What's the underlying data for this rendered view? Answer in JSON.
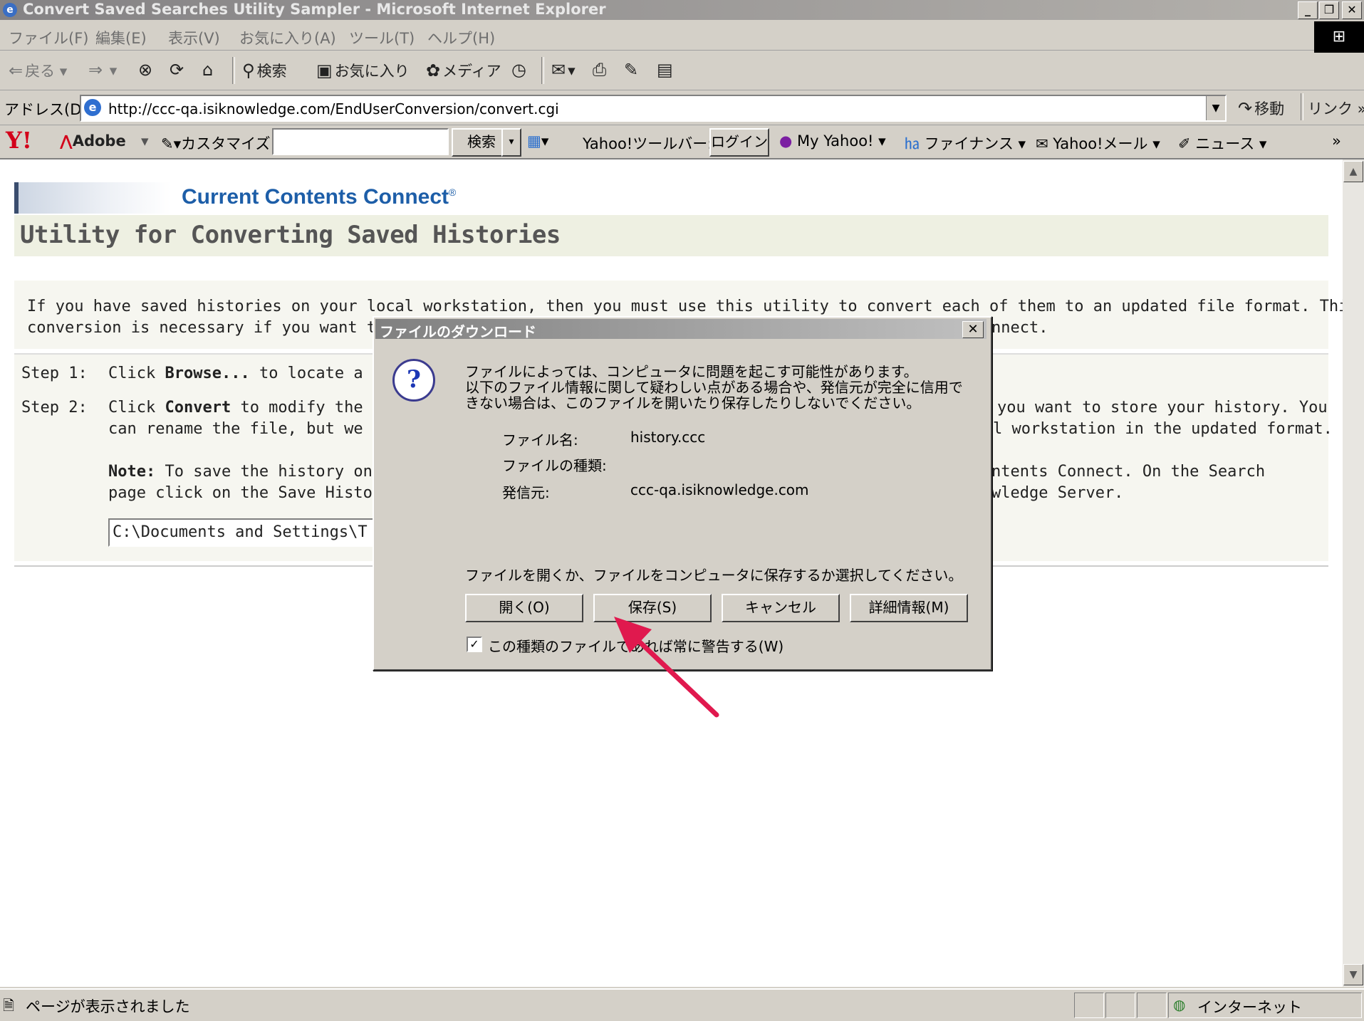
{
  "window": {
    "title": "Convert Saved Searches Utility Sampler - Microsoft Internet Explorer",
    "minimize": "_",
    "maximize": "❐",
    "close": "✕"
  },
  "menubar": {
    "items": [
      "ファイル(F)",
      "編集(E)",
      "表示(V)",
      "お気に入り(A)",
      "ツール(T)",
      "ヘルプ(H)"
    ]
  },
  "toolbar": {
    "back": "戻る",
    "search": "検索",
    "favorites": "お気に入り",
    "media": "メディア"
  },
  "address": {
    "label": "アドレス(D)",
    "url": "http://ccc-qa.isiknowledge.com/EndUserConversion/convert.cgi",
    "go": "移動",
    "links": "リンク"
  },
  "yahoo_toolbar": {
    "logo": "Y!",
    "adobe": "Adobe",
    "customize": "カスタマイズ",
    "search_button": "検索",
    "toolbar_label": "Yahoo!ツールバー:",
    "login": "ログイン",
    "my_yahoo": "My Yahoo!",
    "finance": "ファイナンス",
    "mail": "Yahoo!メール",
    "news": "ニュース"
  },
  "page": {
    "brand": "Current Contents Connect",
    "brand_mark": "®",
    "title": "Utility for Converting Saved Histories",
    "intro_line1": "If you have saved histories on your local workstation, then you must use this utility to convert each of them to an updated file format. This",
    "intro_line2_left": "conversion is necessary if you want to",
    "intro_line2_right": "nnect.",
    "step1_label": "Step 1:",
    "step1_click": "Click ",
    "step1_bold": "Browse...",
    "step1_rest": " to locate a sa",
    "step2_label": "Step 2:",
    "step2_click": "Click ",
    "step2_bold": "Convert",
    "step2_rest": " to modify the s",
    "step2_right": "you want to store your history. You",
    "step2_line2_left": "can rename the file, but we re",
    "step2_line2_right": "l workstation in the updated format.",
    "note_bold": "Note:",
    "note_rest": " To save the history on",
    "note_right": "ntents Connect. On the Search",
    "note_line2_left": "page click on the Save Histor",
    "note_line2_right": "wledge Server.",
    "path_value": "C:\\Documents and Settings\\T"
  },
  "dialog": {
    "title": "ファイルのダウンロード",
    "close": "✕",
    "warning_line1": "ファイルによっては、コンピュータに問題を起こす可能性があります。",
    "warning_line2": "以下のファイル情報に関して疑わしい点がある場合や、発信元が完全に信用で",
    "warning_line3": "きない場合は、このファイルを開いたり保存したりしないでください。",
    "filename_label": "ファイル名:",
    "filename_value": "history.ccc",
    "filetype_label": "ファイルの種類:",
    "source_label": "発信元:",
    "source_value": "ccc-qa.isiknowledge.com",
    "prompt": "ファイルを開くか、ファイルをコンピュータに保存するか選択してください。",
    "open_button": "開く(O)",
    "save_button": "保存(S)",
    "cancel_button": "キャンセル",
    "details_button": "詳細情報(M)",
    "always_warn_label": "この種類のファイルであれば常に警告する(W)",
    "always_warn_checked": true
  },
  "statusbar": {
    "text": "ページが表示されました",
    "zone": "インターネット"
  },
  "colors": {
    "annotation_arrow": "#e0194e",
    "brand": "#1d5ea8"
  }
}
